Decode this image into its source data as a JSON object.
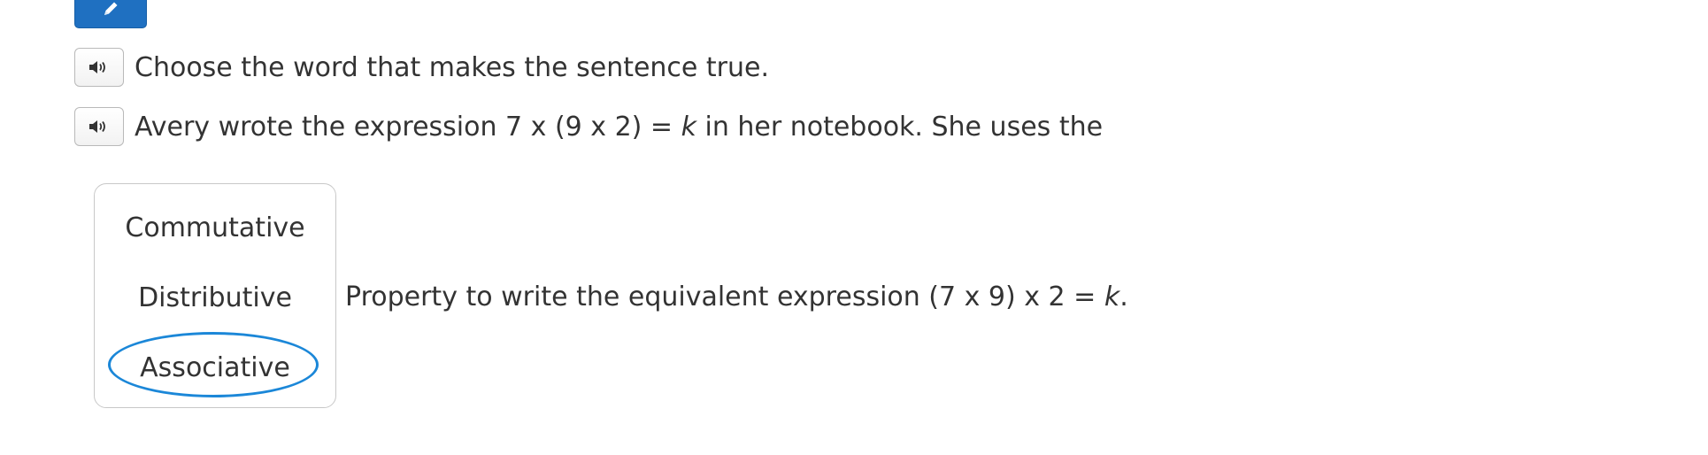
{
  "toolbar": {
    "edit_button_icon": "pencil-icon",
    "accent_color": "#1f70c1"
  },
  "question": {
    "audio_icon": "speaker-icon",
    "instruction": "Choose the word that makes the sentence true.",
    "sentence_start": "Avery wrote the expression 7 x (9 x 2) = ",
    "variable": "k",
    "sentence_mid": " in her notebook. She uses the",
    "sentence_end_start": "Property to write the equivalent expression (7 x 9) x 2 = ",
    "sentence_end_variable": "k",
    "sentence_end_punct": "."
  },
  "choices": {
    "options": [
      "Commutative",
      "Distributive",
      "Associative"
    ],
    "selected": "Associative",
    "selection_color": "#1b87d8"
  }
}
